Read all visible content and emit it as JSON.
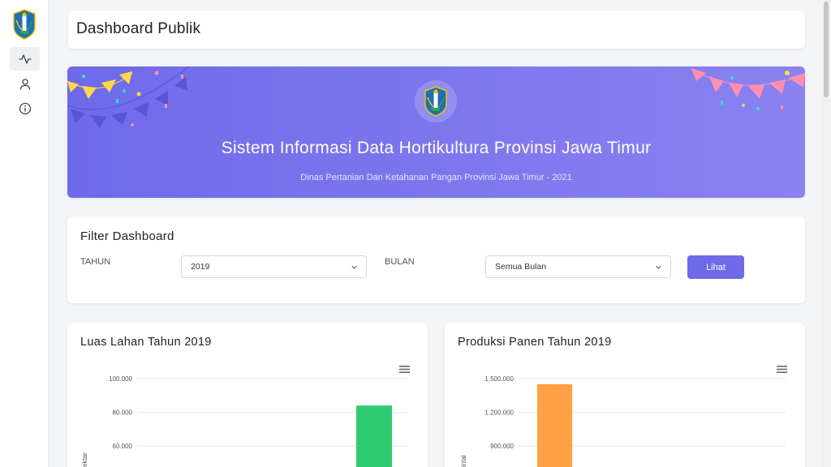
{
  "sidebar": {
    "logo": "east-java-emblem",
    "items": [
      {
        "icon": "activity-icon",
        "active": true
      },
      {
        "icon": "user-icon",
        "active": false
      },
      {
        "icon": "info-icon",
        "active": false
      }
    ]
  },
  "header": {
    "title": "Dashboard Publik"
  },
  "banner": {
    "title": "Sistem Informasi Data Hortikultura Provinsi Jawa Timur",
    "subtitle": "Dinas Pertanian Dan Ketahanan Pangan Provinsi Jawa Timur - 2021",
    "colors": {
      "start": "#6f6aea",
      "end": "#8a82f0"
    }
  },
  "filter": {
    "title": "Filter Dashboard",
    "tahun_label": "TAHUN",
    "tahun_value": "2019",
    "bulan_label": "BULAN",
    "bulan_value": "Semua Bulan",
    "button_label": "Lihat"
  },
  "colors": {
    "accent": "#6f6aea",
    "green_bar": "#2ecc71",
    "orange_bar": "#ffa044"
  },
  "chart_data": [
    {
      "type": "bar",
      "title": "Luas Lahan Tahun 2019",
      "ylabel": "ektar",
      "yticks": [
        "100.000",
        "80.000",
        "60.000"
      ],
      "ytick_values": [
        100000,
        80000,
        60000
      ],
      "series": [
        {
          "values": [
            84000
          ],
          "color": "#2ecc71"
        }
      ]
    },
    {
      "type": "bar",
      "title": "Produksi Panen Tahun 2019",
      "ylabel": "intal",
      "yticks": [
        "1.500.000",
        "1.200.000",
        "900.000"
      ],
      "ytick_values": [
        1500000,
        1200000,
        900000
      ],
      "series": [
        {
          "values": [
            1450000
          ],
          "color": "#ffa044"
        }
      ]
    }
  ]
}
